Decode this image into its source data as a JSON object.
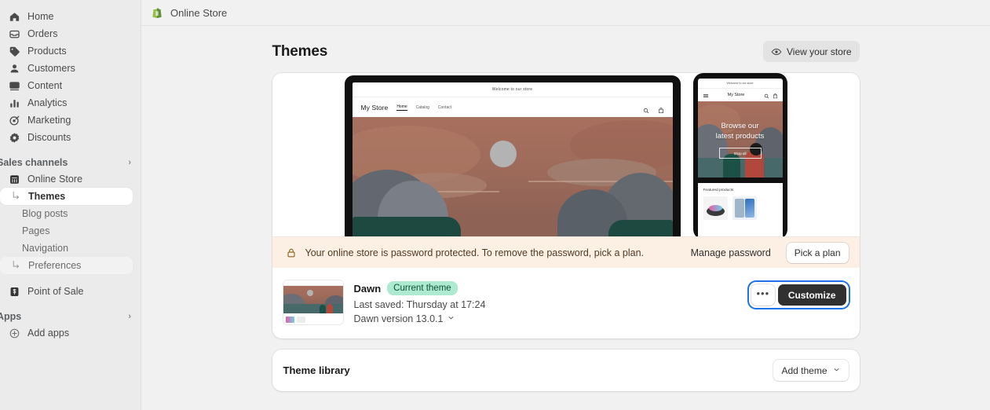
{
  "sidebar": {
    "primary": [
      {
        "label": "Home",
        "icon": "home-icon"
      },
      {
        "label": "Orders",
        "icon": "orders-icon"
      },
      {
        "label": "Products",
        "icon": "products-tag-icon"
      },
      {
        "label": "Customers",
        "icon": "customers-person-icon"
      },
      {
        "label": "Content",
        "icon": "content-image-icon"
      },
      {
        "label": "Analytics",
        "icon": "analytics-bars-icon"
      },
      {
        "label": "Marketing",
        "icon": "marketing-target-icon"
      },
      {
        "label": "Discounts",
        "icon": "discounts-badge-icon"
      }
    ],
    "sales_channels": {
      "label": "Sales channels",
      "items": [
        {
          "label": "Online Store",
          "icon": "storefront-icon",
          "level": "channel"
        },
        {
          "label": "Themes",
          "level": "sub",
          "active": true,
          "indent_marker": true
        },
        {
          "label": "Blog posts",
          "level": "sub"
        },
        {
          "label": "Pages",
          "level": "sub"
        },
        {
          "label": "Navigation",
          "level": "sub"
        },
        {
          "label": "Preferences",
          "level": "sub",
          "hover": true,
          "indent_marker": true
        },
        {
          "label": "Point of Sale",
          "icon": "pos-icon",
          "level": "channel"
        }
      ]
    },
    "apps": {
      "label": "Apps",
      "items": [
        {
          "label": "Add apps",
          "icon": "add-circle-icon"
        }
      ]
    }
  },
  "topbar": {
    "app_name": "Online Store",
    "app_icon": "shopify-bag-icon"
  },
  "page": {
    "title": "Themes",
    "view_store_button": "View your store",
    "view_store_icon": "eye-icon"
  },
  "preview": {
    "desktop": {
      "announcement": "Welcome to our store",
      "brand": "My Store",
      "nav": [
        "Home",
        "Catalog",
        "Contact"
      ],
      "active_nav": "Home",
      "search_icon": "search-icon",
      "cart_icon": "cart-icon"
    },
    "mobile": {
      "announcement": "Welcome to our store",
      "brand": "My Store",
      "menu_icon": "hamburger-icon",
      "search_icon": "search-icon",
      "cart_icon": "cart-icon",
      "hero_heading_line1": "Browse our",
      "hero_heading_line2": "latest products",
      "hero_button": "Shop all",
      "featured_title": "Featured products"
    }
  },
  "banner": {
    "icon": "lock-icon",
    "message": "Your online store is password protected. To remove the password, pick a plan.",
    "manage_link": "Manage password",
    "plan_button": "Pick a plan",
    "background": "#fcefe3"
  },
  "theme": {
    "name": "Dawn",
    "badge": "Current theme",
    "badge_color": "#aee9d1",
    "last_saved": "Last saved: Thursday at 17:24",
    "version": "Dawn version 13.0.1",
    "version_chevron": "chevron-down-icon",
    "more_button": "•••",
    "customize_button": "Customize",
    "focus_ring_color": "#1a73e8"
  },
  "library": {
    "title": "Theme library",
    "add_theme_button": "Add theme",
    "add_theme_chevron": "chevron-down-icon"
  }
}
